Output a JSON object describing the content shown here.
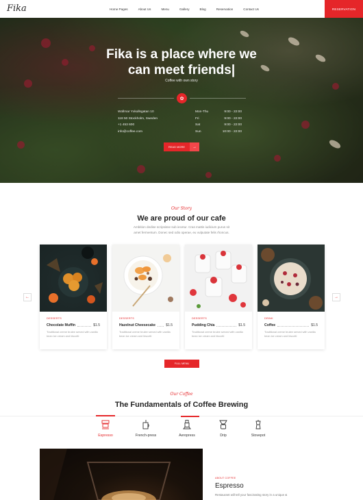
{
  "nav": {
    "logo": "Fika",
    "items": [
      "Home Pages",
      "About Us",
      "Menu",
      "Gallery",
      "Blog",
      "Reservation",
      "Contact Us"
    ],
    "reservation_button": "RESERVATION"
  },
  "hero": {
    "title_line1": "Fika is a place where we",
    "title_line2": "can meet friends|",
    "subtitle": "Coffee with own story",
    "address": [
      "Wollmar Yxkullsgatan 10",
      "118 50 Stockholm, Sweden",
      "+1 453 600",
      "info@coffee.com"
    ],
    "hours": [
      {
        "day": "Mon-Thu",
        "time": "9:00 - 22:00"
      },
      {
        "day": "Fri",
        "time": "9:00 - 22:00"
      },
      {
        "day": "Sat",
        "time": "9:00 - 22:00"
      },
      {
        "day": "Sun",
        "time": "10:00 - 22:00"
      }
    ],
    "read_more": "READ MORE",
    "arrow": "→"
  },
  "story": {
    "script": "Our Story",
    "title": "We are proud of our cafe",
    "desc": "Ambition dedise scripsisse sub iecetur. Cras mattis iudicium purus sit amet fermentum. Donec sed odio operae, eu vulputate felis rhoncus."
  },
  "cards": [
    {
      "category": "DESSERTS",
      "name": "Chocolate Muffin",
      "price": "$1.5",
      "desc": "Traditional creme brulee served with vanilla bean ice cream and biscotti"
    },
    {
      "category": "DESSERTS",
      "name": "Hazelnut Cheesecake",
      "price": "$1.5",
      "desc": "Traditional creme brulee served with vanilla bean ice cream and biscotti"
    },
    {
      "category": "DESSERTS",
      "name": "Pudding Chia",
      "price": "$1.5",
      "desc": "Traditional creme brulee served with vanilla bean ice cream and biscotti"
    },
    {
      "category": "DRINK",
      "name": "Coffee",
      "price": "$1.5",
      "desc": "Traditional creme brulee served with vanilla bean ice cream and biscotti"
    }
  ],
  "carousel": {
    "prev": "←",
    "next": "→"
  },
  "full_menu": "FULL MENU",
  "coffee": {
    "script": "Our Coffee",
    "title": "The Fundamentals of Coffee Brewing",
    "tabs": [
      "Espresso",
      "French-press",
      "Aeropress",
      "Drip",
      "Stovepot"
    ],
    "active_tab": "Espresso",
    "detail_category": "ABOUT COFFEE",
    "detail_title": "Espresso",
    "detail_desc": "Restaurant will tell your fascinating story in a unique &"
  },
  "colors": {
    "accent": "#e52629"
  }
}
